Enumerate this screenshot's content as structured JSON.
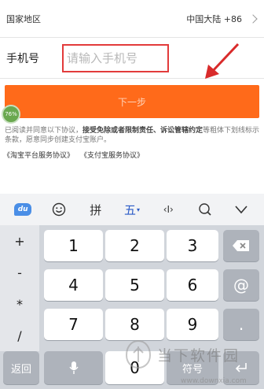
{
  "form": {
    "country_label": "国家地区",
    "country_value": "中国大陆 +86",
    "phone_label": "手机号",
    "phone_placeholder": "请输入手机号",
    "next_label": "下一步"
  },
  "badge": {
    "percent_text": "76%"
  },
  "agreement": {
    "part1": "已阅读并同意以下协议，",
    "bold": "接受免除或者限制责任、诉讼管辖约定",
    "part2": "等粗体下划线标示条款，愿意同步创建支付宝账户。",
    "link1": "《淘宝平台服务协议》",
    "link2": "《支付宝服务协议》"
  },
  "keyboard": {
    "toolbar": [
      "du",
      "emoji",
      "拼",
      "五",
      "cursor",
      "search",
      "hide"
    ],
    "toolbar_wubi": "五",
    "toolbar_pinyin": "拼",
    "toolbar_cursor": "‹I›",
    "logo_text": "du",
    "symbols": [
      "+",
      "-",
      "*",
      "/"
    ],
    "digits": [
      "1",
      "2",
      "3",
      "4",
      "5",
      "6",
      "7",
      "8",
      "9",
      "0"
    ],
    "back_label": "返回",
    "symbol_label": "符号",
    "at_label": "@",
    "dot_label": "."
  },
  "watermark": {
    "text": "当下软件园",
    "url": "www.downxia.com"
  }
}
